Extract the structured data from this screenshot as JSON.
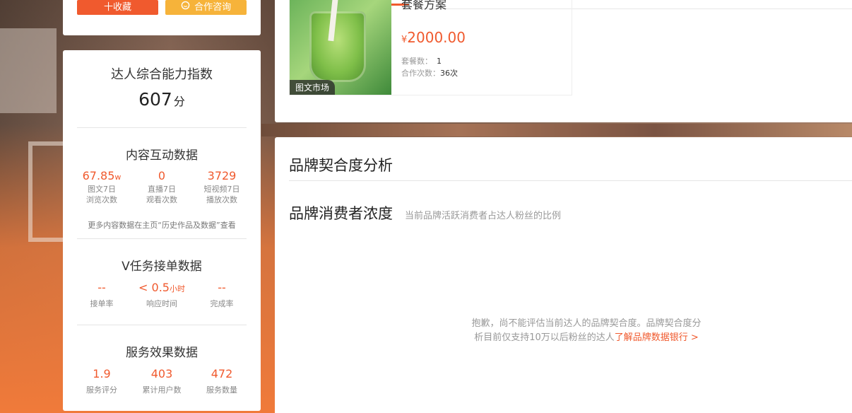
{
  "top_buttons": {
    "favorite_label": "十收藏",
    "cooperate_label": "合作咨询",
    "cooperate_icon": "chat-bubble-icon"
  },
  "ability": {
    "title": "达人综合能力指数",
    "score": "607",
    "unit": "分"
  },
  "content_interaction": {
    "title": "内容互动数据",
    "stats": [
      {
        "value": "67.85",
        "unit": "w",
        "label1": "图文7日",
        "label2": "浏览次数"
      },
      {
        "value": "0",
        "unit": "",
        "label1": "直播7日",
        "label2": "观看次数"
      },
      {
        "value": "3729",
        "unit": "",
        "label1": "短视频7日",
        "label2": "播放次数"
      }
    ],
    "note": "更多内容数据在主页“历史作品及数据”查看"
  },
  "v_task": {
    "title": "V任务接单数据",
    "stats": [
      {
        "value": "--",
        "unit": "",
        "label": "接单率"
      },
      {
        "value": "< 0.5",
        "unit": "小时",
        "label": "响应时间"
      },
      {
        "value": "--",
        "unit": "",
        "label": "完成率"
      }
    ]
  },
  "service": {
    "title": "服务效果数据",
    "stats": [
      {
        "value": "1.9",
        "label": "服务评分"
      },
      {
        "value": "403",
        "label": "累计用户数"
      },
      {
        "value": "472",
        "label": "服务数量"
      }
    ]
  },
  "package": {
    "title": "套餐方案",
    "price_currency": "¥",
    "price": "2000.00",
    "count_label": "套餐数：",
    "count": "1",
    "coop_label": "合作次数：",
    "coop": "36次",
    "badge": "图文市场"
  },
  "brand_fit": {
    "title": "品牌契合度分析",
    "subtitle": "品牌消费者浓度",
    "description": "当前品牌活跃消费者占达人粉丝的比例",
    "empty_text": "抱歉，尚不能评估当前达人的品牌契合度。品牌契合度分析目前仅支持10万以后粉丝的达人",
    "link_text": "了解品牌数据银行 >"
  },
  "colors": {
    "accent": "#f05a2e",
    "secondary": "#f6b33a"
  }
}
